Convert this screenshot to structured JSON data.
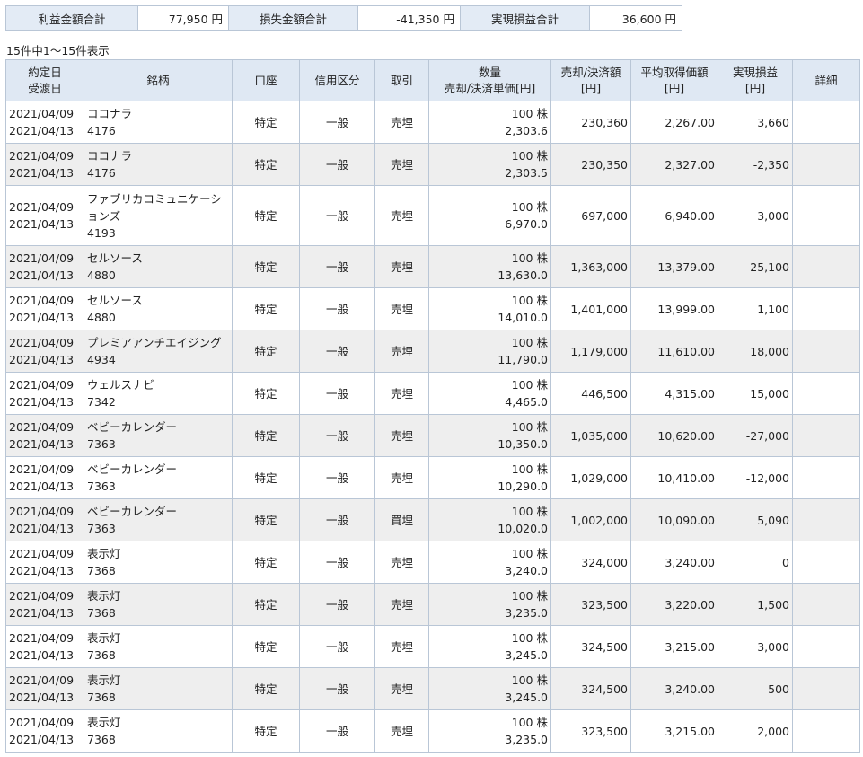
{
  "summary": {
    "profit_label": "利益金額合計",
    "profit_value": "77,950 円",
    "loss_label": "損失金額合計",
    "loss_value": "-41,350 円",
    "realized_label": "実現損益合計",
    "realized_value": "36,600 円"
  },
  "count_text": "15件中1～15件表示",
  "headers": {
    "date1": "約定日",
    "date2": "受渡日",
    "name": "銘柄",
    "account": "口座",
    "credit": "信用区分",
    "trade": "取引",
    "qty1": "数量",
    "qty2": "売却/決済単価[円]",
    "amt1": "売却/決済額",
    "amt2": "[円]",
    "avg1": "平均取得価額",
    "avg2": "[円]",
    "pl1": "実現損益",
    "pl2": "[円]",
    "detail": "詳細"
  },
  "rows": [
    {
      "exec": "2021/04/09",
      "settle": "2021/04/13",
      "name": "ココナラ",
      "code": "4176",
      "account": "特定",
      "credit": "一般",
      "trade": "売埋",
      "qty": "100 株",
      "price": "2,303.6",
      "amount": "230,360",
      "avg": "2,267.00",
      "pl": "3,660"
    },
    {
      "exec": "2021/04/09",
      "settle": "2021/04/13",
      "name": "ココナラ",
      "code": "4176",
      "account": "特定",
      "credit": "一般",
      "trade": "売埋",
      "qty": "100 株",
      "price": "2,303.5",
      "amount": "230,350",
      "avg": "2,327.00",
      "pl": "-2,350"
    },
    {
      "exec": "2021/04/09",
      "settle": "2021/04/13",
      "name": "ファブリカコミュニケーションズ",
      "code": "4193",
      "account": "特定",
      "credit": "一般",
      "trade": "売埋",
      "qty": "100 株",
      "price": "6,970.0",
      "amount": "697,000",
      "avg": "6,940.00",
      "pl": "3,000"
    },
    {
      "exec": "2021/04/09",
      "settle": "2021/04/13",
      "name": "セルソース",
      "code": "4880",
      "account": "特定",
      "credit": "一般",
      "trade": "売埋",
      "qty": "100 株",
      "price": "13,630.0",
      "amount": "1,363,000",
      "avg": "13,379.00",
      "pl": "25,100"
    },
    {
      "exec": "2021/04/09",
      "settle": "2021/04/13",
      "name": "セルソース",
      "code": "4880",
      "account": "特定",
      "credit": "一般",
      "trade": "売埋",
      "qty": "100 株",
      "price": "14,010.0",
      "amount": "1,401,000",
      "avg": "13,999.00",
      "pl": "1,100"
    },
    {
      "exec": "2021/04/09",
      "settle": "2021/04/13",
      "name": "プレミアアンチエイジング",
      "code": "4934",
      "account": "特定",
      "credit": "一般",
      "trade": "売埋",
      "qty": "100 株",
      "price": "11,790.0",
      "amount": "1,179,000",
      "avg": "11,610.00",
      "pl": "18,000"
    },
    {
      "exec": "2021/04/09",
      "settle": "2021/04/13",
      "name": "ウェルスナビ",
      "code": "7342",
      "account": "特定",
      "credit": "一般",
      "trade": "売埋",
      "qty": "100 株",
      "price": "4,465.0",
      "amount": "446,500",
      "avg": "4,315.00",
      "pl": "15,000"
    },
    {
      "exec": "2021/04/09",
      "settle": "2021/04/13",
      "name": "ベビーカレンダー",
      "code": "7363",
      "account": "特定",
      "credit": "一般",
      "trade": "売埋",
      "qty": "100 株",
      "price": "10,350.0",
      "amount": "1,035,000",
      "avg": "10,620.00",
      "pl": "-27,000"
    },
    {
      "exec": "2021/04/09",
      "settle": "2021/04/13",
      "name": "ベビーカレンダー",
      "code": "7363",
      "account": "特定",
      "credit": "一般",
      "trade": "売埋",
      "qty": "100 株",
      "price": "10,290.0",
      "amount": "1,029,000",
      "avg": "10,410.00",
      "pl": "-12,000"
    },
    {
      "exec": "2021/04/09",
      "settle": "2021/04/13",
      "name": "ベビーカレンダー",
      "code": "7363",
      "account": "特定",
      "credit": "一般",
      "trade": "買埋",
      "qty": "100 株",
      "price": "10,020.0",
      "amount": "1,002,000",
      "avg": "10,090.00",
      "pl": "5,090"
    },
    {
      "exec": "2021/04/09",
      "settle": "2021/04/13",
      "name": "表示灯",
      "code": "7368",
      "account": "特定",
      "credit": "一般",
      "trade": "売埋",
      "qty": "100 株",
      "price": "3,240.0",
      "amount": "324,000",
      "avg": "3,240.00",
      "pl": "0"
    },
    {
      "exec": "2021/04/09",
      "settle": "2021/04/13",
      "name": "表示灯",
      "code": "7368",
      "account": "特定",
      "credit": "一般",
      "trade": "売埋",
      "qty": "100 株",
      "price": "3,235.0",
      "amount": "323,500",
      "avg": "3,220.00",
      "pl": "1,500"
    },
    {
      "exec": "2021/04/09",
      "settle": "2021/04/13",
      "name": "表示灯",
      "code": "7368",
      "account": "特定",
      "credit": "一般",
      "trade": "売埋",
      "qty": "100 株",
      "price": "3,245.0",
      "amount": "324,500",
      "avg": "3,215.00",
      "pl": "3,000"
    },
    {
      "exec": "2021/04/09",
      "settle": "2021/04/13",
      "name": "表示灯",
      "code": "7368",
      "account": "特定",
      "credit": "一般",
      "trade": "売埋",
      "qty": "100 株",
      "price": "3,245.0",
      "amount": "324,500",
      "avg": "3,240.00",
      "pl": "500"
    },
    {
      "exec": "2021/04/09",
      "settle": "2021/04/13",
      "name": "表示灯",
      "code": "7368",
      "account": "特定",
      "credit": "一般",
      "trade": "売埋",
      "qty": "100 株",
      "price": "3,235.0",
      "amount": "323,500",
      "avg": "3,215.00",
      "pl": "2,000"
    }
  ]
}
